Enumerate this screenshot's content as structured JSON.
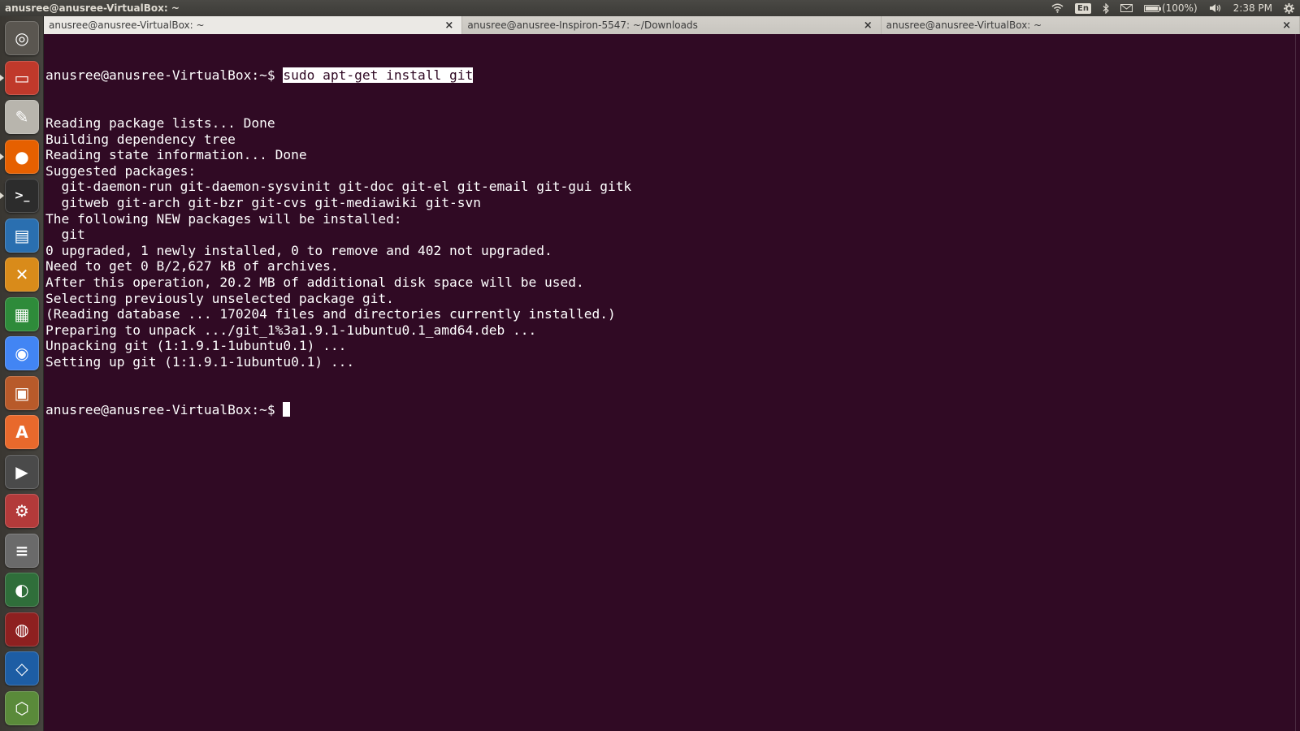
{
  "top_panel": {
    "window_title": "anusree@anusree-VirtualBox: ~",
    "keyboard_layout": "En",
    "battery": {
      "label": "(100%)",
      "level": 1.0
    },
    "clock": "2:38 PM",
    "icons": [
      "wifi-icon",
      "keyboard-icon",
      "bluetooth-icon",
      "mail-icon",
      "battery-icon",
      "volume-icon",
      "gear-icon"
    ]
  },
  "launcher": {
    "items": [
      {
        "name": "dash-home",
        "glyph": "◎",
        "bg": "#5a5650"
      },
      {
        "name": "files",
        "glyph": "▭",
        "bg": "#c0392b"
      },
      {
        "name": "text-editor",
        "glyph": "✎",
        "bg": "#b8b5ad"
      },
      {
        "name": "firefox",
        "glyph": "●",
        "bg": "#e66000"
      },
      {
        "name": "terminal",
        "glyph": ">_",
        "bg": "#2c2c2c"
      },
      {
        "name": "libreoffice-writer",
        "glyph": "▤",
        "bg": "#2a6fb0"
      },
      {
        "name": "xchat",
        "glyph": "✕",
        "bg": "#d98b1a"
      },
      {
        "name": "libreoffice-calc",
        "glyph": "▦",
        "bg": "#2e8b3a"
      },
      {
        "name": "chrome",
        "glyph": "◉",
        "bg": "#4285f4"
      },
      {
        "name": "libreoffice-impress",
        "glyph": "▣",
        "bg": "#b85a2a"
      },
      {
        "name": "software-center",
        "glyph": "A",
        "bg": "#e8692c"
      },
      {
        "name": "video-editor",
        "glyph": "▶",
        "bg": "#4a4a4a"
      },
      {
        "name": "system-settings",
        "glyph": "⚙",
        "bg": "#b33a3a"
      },
      {
        "name": "workspace-switcher",
        "glyph": "≡",
        "bg": "#6a6a6a"
      },
      {
        "name": "web-browser",
        "glyph": "◐",
        "bg": "#2f6e3a"
      },
      {
        "name": "remote-desktop",
        "glyph": "◍",
        "bg": "#8e2020"
      },
      {
        "name": "virtualbox",
        "glyph": "◇",
        "bg": "#1d5da4"
      },
      {
        "name": "backup",
        "glyph": "⬡",
        "bg": "#5a8a3a"
      }
    ]
  },
  "terminal": {
    "tabs": [
      {
        "label": "anusree@anusree-VirtualBox: ~",
        "active": true
      },
      {
        "label": "anusree@anusree-Inspiron-5547: ~/Downloads",
        "active": false
      },
      {
        "label": "anusree@anusree-VirtualBox: ~",
        "active": false
      }
    ],
    "prompt": "anusree@anusree-VirtualBox:~$ ",
    "command": "sudo apt-get install git",
    "output": [
      "Reading package lists... Done",
      "Building dependency tree",
      "Reading state information... Done",
      "Suggested packages:",
      "  git-daemon-run git-daemon-sysvinit git-doc git-el git-email git-gui gitk",
      "  gitweb git-arch git-bzr git-cvs git-mediawiki git-svn",
      "The following NEW packages will be installed:",
      "  git",
      "0 upgraded, 1 newly installed, 0 to remove and 402 not upgraded.",
      "Need to get 0 B/2,627 kB of archives.",
      "After this operation, 20.2 MB of additional disk space will be used.",
      "Selecting previously unselected package git.",
      "(Reading database ... 170204 files and directories currently installed.)",
      "Preparing to unpack .../git_1%3a1.9.1-1ubuntu0.1_amd64.deb ...",
      "Unpacking git (1:1.9.1-1ubuntu0.1) ...",
      "Setting up git (1:1.9.1-1ubuntu0.1) ..."
    ],
    "final_prompt": "anusree@anusree-VirtualBox:~$ ",
    "colors": {
      "background": "#300a24",
      "foreground": "#ffffff"
    }
  }
}
